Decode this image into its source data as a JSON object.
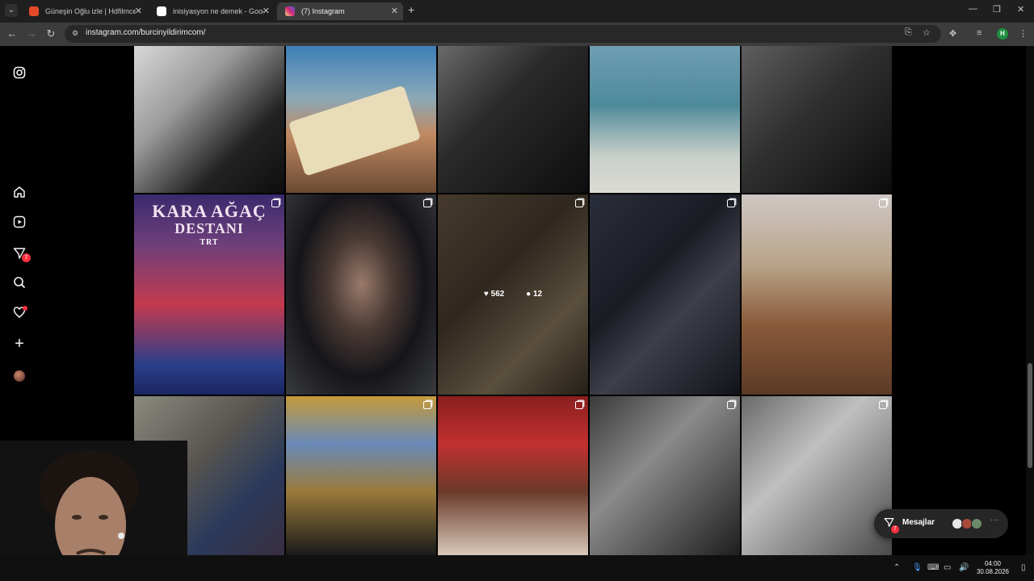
{
  "tabs": [
    {
      "title": "Güneşin Oğlu izle | Hdfilmcehennemi",
      "favicon_color": "#e34a2a",
      "active": false
    },
    {
      "title": "inisiyasyon ne demek - Google Search",
      "favicon_color": "#ffffff",
      "active": false
    },
    {
      "title": "(7) Instagram",
      "favicon_color": "#d6249f",
      "active": true
    }
  ],
  "window_controls": {
    "minimize": "—",
    "restore": "❐",
    "close": "✕"
  },
  "address_bar": {
    "url": "instagram.com/burcinyildirimcom/"
  },
  "profile_initial": "H",
  "sidebar": {
    "messages_badge": "7",
    "icons": [
      "instagram-logo",
      "home",
      "reels",
      "messages",
      "search",
      "notifications",
      "create",
      "profile"
    ]
  },
  "grid": {
    "poster_title_line1": "KARA AĞAÇ",
    "poster_title_line2": "DESTANI",
    "poster_channel": "TRT",
    "hovered_post": {
      "likes": "562",
      "comments": "12"
    }
  },
  "messages_pill": {
    "label": "Mesajlar",
    "badge": "7"
  },
  "taskbar": {
    "time": "04:00",
    "date": "30.08.2026"
  }
}
